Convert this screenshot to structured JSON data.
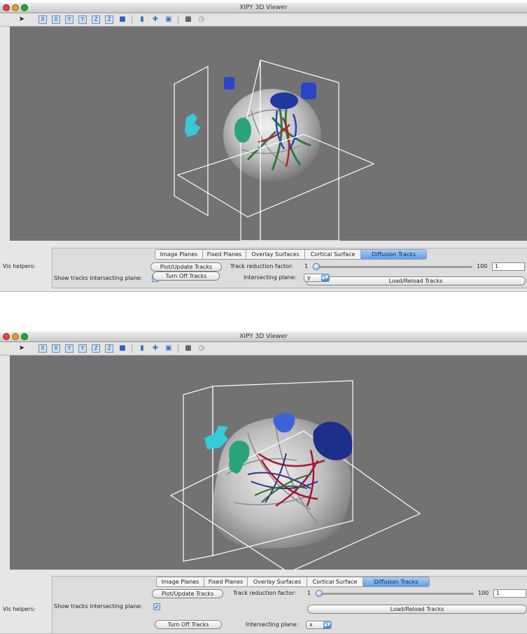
{
  "windows": [
    {
      "title": "XIPY 3D Viewer",
      "panel": {
        "vis_helpers_label": "Vis helpers:",
        "tabs": [
          {
            "label": "Image Planes",
            "active": false
          },
          {
            "label": "Fixed Planes",
            "active": false
          },
          {
            "label": "Overlay Surfaces",
            "active": false
          },
          {
            "label": "Cortical Surface",
            "active": false
          },
          {
            "label": "Diffusion Tracks",
            "active": true
          }
        ],
        "plot_update_button": "Plot/Update Tracks",
        "turn_off_button": "Turn Off Tracks",
        "show_tracks_label": "Show tracks intersecting plane:",
        "show_tracks_checked": true,
        "reduction_label": "Track reduction factor:",
        "reduction_min": "1",
        "reduction_max": "100",
        "reduction_value": "1",
        "reduction_level": 0.0,
        "load_reload_button": "Load/Reload Tracks",
        "intersecting_plane_label": "Intersecting plane:",
        "intersecting_plane_value": "y"
      }
    },
    {
      "title": "XIPY 3D Viewer",
      "panel": {
        "vis_helpers_label": "Vis helpers:",
        "tabs": [
          {
            "label": "Image Planes",
            "active": false
          },
          {
            "label": "Fixed Planes",
            "active": false
          },
          {
            "label": "Overlay Surfaces",
            "active": false
          },
          {
            "label": "Cortical Surface",
            "active": false
          },
          {
            "label": "Diffusion Tracks",
            "active": true
          }
        ],
        "plot_update_button": "Plot/Update Tracks",
        "turn_off_button": "Turn Off Tracks",
        "show_tracks_label": "Show tracks intersecting plane:",
        "show_tracks_checked": true,
        "reduction_label": "Track reduction factor:",
        "reduction_min": "1",
        "reduction_max": "100",
        "reduction_value": "1",
        "reduction_level": 0.0,
        "load_reload_button": "Load/Reload Tracks",
        "intersecting_plane_label": "Intersecting plane:",
        "intersecting_plane_value": "x"
      }
    }
  ],
  "toolbar_icons": [
    "navigate-icon",
    "plane-x-icon",
    "plane-x-alt-icon",
    "plane-y-icon",
    "plane-y-alt-icon",
    "plane-z-icon",
    "plane-z-alt-icon",
    "volume-cube-icon",
    "surface-icon",
    "crosshair-icon",
    "fit-view-icon",
    "save-icon",
    "reset-view-icon"
  ],
  "colors": {
    "viewport_bg": "#727272",
    "active_tab": "#5f9ee8",
    "overlay_cyan": "#38c9d6",
    "overlay_blue": "#2b45c9",
    "overlay_green": "#2aa37a"
  }
}
